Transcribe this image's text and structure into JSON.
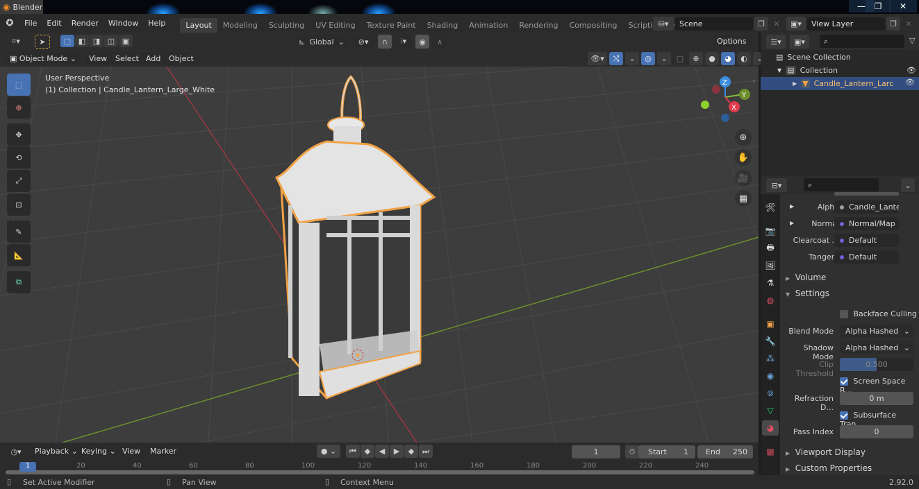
{
  "window": {
    "title": "Blender",
    "controls": [
      "minimize",
      "restore",
      "close"
    ]
  },
  "topbar": {
    "menus": [
      "File",
      "Edit",
      "Render",
      "Window",
      "Help"
    ],
    "workspaces": [
      "Layout",
      "Modeling",
      "Sculpting",
      "UV Editing",
      "Texture Paint",
      "Shading",
      "Animation",
      "Rendering",
      "Compositing",
      "Scripting"
    ],
    "active_workspace": "Layout",
    "add_workspace": "+",
    "scene": "Scene",
    "view_layer": "View Layer"
  },
  "tool_settings": {
    "transform_orientation": "Global",
    "options_label": "Options"
  },
  "viewport_header": {
    "mode": "Object Mode",
    "menus": [
      "View",
      "Select",
      "Add",
      "Object"
    ]
  },
  "viewport": {
    "perspective_label": "User Perspective",
    "context_label": "(1) Collection | Candle_Lantern_Large_White",
    "gizmo_axes": [
      "X",
      "Y",
      "Z"
    ]
  },
  "outliner": {
    "scene_collection": "Scene Collection",
    "collection": "Collection",
    "object": "Candle_Lantern_Larc"
  },
  "properties": {
    "inputs": [
      {
        "label": "Alpha",
        "value": "Candle_Lante...",
        "dot": "#a0a0a0",
        "expand": true
      },
      {
        "label": "Normal",
        "value": "Normal/Map",
        "dot": "#6e63d8",
        "expand": true
      },
      {
        "label": "Clearcoat ...",
        "value": "Default",
        "dot": "#6e63d8",
        "expand": false
      },
      {
        "label": "Tangent",
        "value": "Default",
        "dot": "#6e63d8",
        "expand": false
      }
    ],
    "panels": {
      "volume": "Volume",
      "settings": "Settings",
      "viewport_display": "Viewport Display",
      "custom_properties": "Custom Properties"
    },
    "settings": {
      "backface_culling": {
        "label": "Backface Culling",
        "checked": false
      },
      "blend_mode": {
        "label": "Blend Mode",
        "value": "Alpha Hashed"
      },
      "shadow_mode": {
        "label": "Shadow Mode",
        "value": "Alpha Hashed"
      },
      "clip_threshold": {
        "label": "Clip Threshold",
        "value": "0.500",
        "fraction": 0.5
      },
      "screen_space_refraction": {
        "label": "Screen Space R...",
        "checked": true
      },
      "refraction_depth": {
        "label": "Refraction D...",
        "value": "0 m"
      },
      "subsurface_translucency": {
        "label": "Subsurface Tran...",
        "checked": true
      },
      "pass_index": {
        "label": "Pass Index",
        "value": "0"
      }
    }
  },
  "timeline": {
    "menus": [
      "Playback",
      "Keying",
      "View",
      "Marker"
    ],
    "current_frame": "1",
    "start_label": "Start",
    "start": "1",
    "end_label": "End",
    "end": "250",
    "ticks": [
      "1",
      "20",
      "40",
      "60",
      "80",
      "100",
      "120",
      "140",
      "160",
      "180",
      "200",
      "220",
      "240"
    ]
  },
  "statusbar": {
    "left_hint": "Set Active Modifier",
    "middle_hint": "Pan View",
    "right_hint": "Context Menu",
    "version": "2.92.0"
  },
  "colors": {
    "accent": "#4772b3",
    "selection_outline": "#f1a246",
    "x_axis": "#e23b4e",
    "y_axis": "#8bbf3a",
    "z_axis": "#3d8de0"
  }
}
